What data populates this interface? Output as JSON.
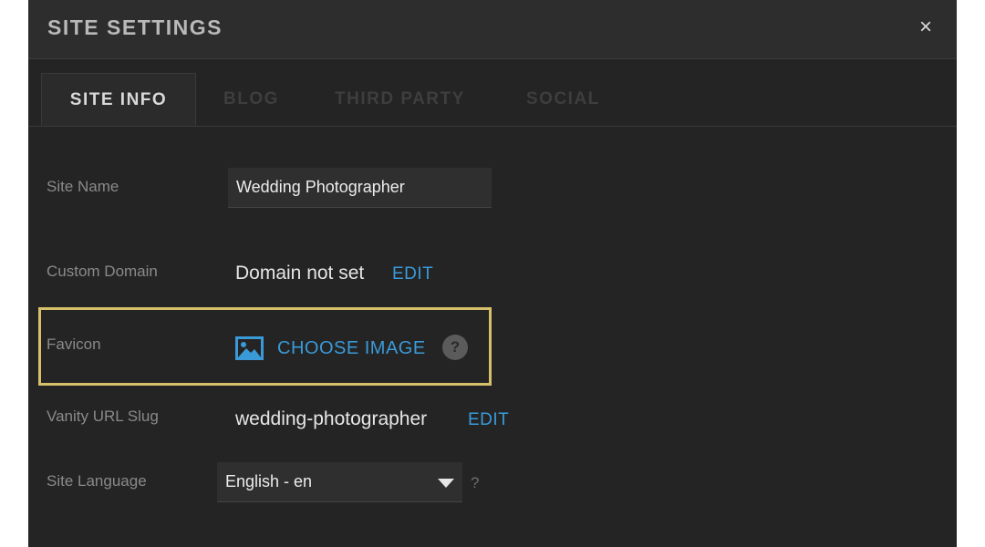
{
  "dialog": {
    "title": "SITE SETTINGS",
    "close_label": "×"
  },
  "tabs": [
    {
      "label": "SITE INFO",
      "active": true
    },
    {
      "label": "BLOG",
      "active": false
    },
    {
      "label": "THIRD PARTY",
      "active": false
    },
    {
      "label": "SOCIAL",
      "active": false
    }
  ],
  "site_name": {
    "label": "Site Name",
    "value": "Wedding Photographer"
  },
  "custom_domain": {
    "label": "Custom Domain",
    "value": "Domain not set",
    "edit_label": "EDIT"
  },
  "favicon": {
    "label": "Favicon",
    "choose_label": "CHOOSE IMAGE",
    "help_label": "?",
    "icon": "image-icon"
  },
  "vanity_url": {
    "label": "Vanity URL Slug",
    "value": "wedding-photographer",
    "edit_label": "EDIT"
  },
  "site_language": {
    "label": "Site Language",
    "selected": "English - en",
    "help_label": "?"
  },
  "colors": {
    "background": "#242424",
    "header": "#2d2d2d",
    "accent": "#3a9ad8",
    "highlight": "#d6c06a"
  }
}
